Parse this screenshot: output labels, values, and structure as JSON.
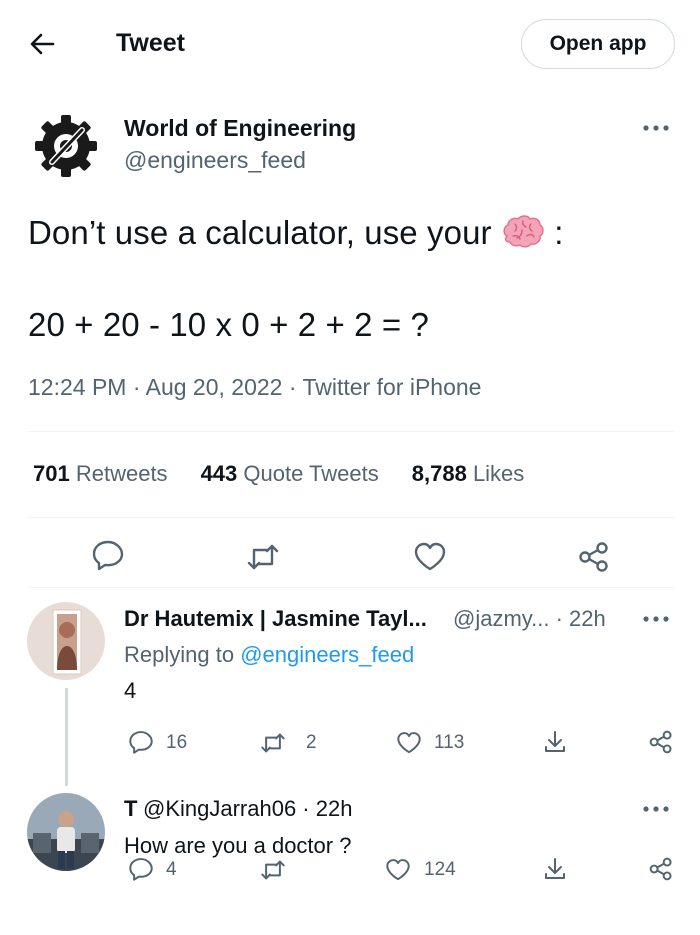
{
  "header": {
    "title": "Tweet",
    "open_app": "Open app"
  },
  "author": {
    "name": "World of Engineering",
    "handle": "@engineers_feed"
  },
  "tweet": {
    "line1": "Don’t use a calculator, use your",
    "line1_suffix": ":",
    "line2": "20 + 20 - 10 x 0 + 2 + 2 = ?",
    "meta": "12:24 PM · Aug 20, 2022 · Twitter for iPhone"
  },
  "stats": {
    "retweets_count": "701",
    "retweets_label": "Retweets",
    "quotes_count": "443",
    "quotes_label": "Quote Tweets",
    "likes_count": "8,788",
    "likes_label": "Likes"
  },
  "replies": [
    {
      "name": "Dr Hautemix | Jasmine Tayl...",
      "handle_time": "@jazmy... · 22h",
      "replying_prefix": "Replying to",
      "replying_handle": "@engineers_feed",
      "text": "4",
      "reply_count": "16",
      "retweet_count": "2",
      "like_count": "113"
    },
    {
      "name": "T",
      "handle_time": "@KingJarrah06 · 22h",
      "text": "How are you a doctor ?",
      "reply_count": "4",
      "retweet_count": "",
      "like_count": "124"
    }
  ],
  "icons": {
    "back": "arrow-left-icon",
    "more": "more-horizontal-icon",
    "reply": "reply-icon",
    "retweet": "retweet-icon",
    "like": "heart-icon",
    "share": "share-icon",
    "download": "download-icon",
    "brain": "brain-emoji-icon",
    "logo": "gear-logo-icon"
  },
  "colors": {
    "text": "#0f1419",
    "muted": "#536471",
    "link": "#1d9bf0",
    "border": "#cfd9de"
  }
}
